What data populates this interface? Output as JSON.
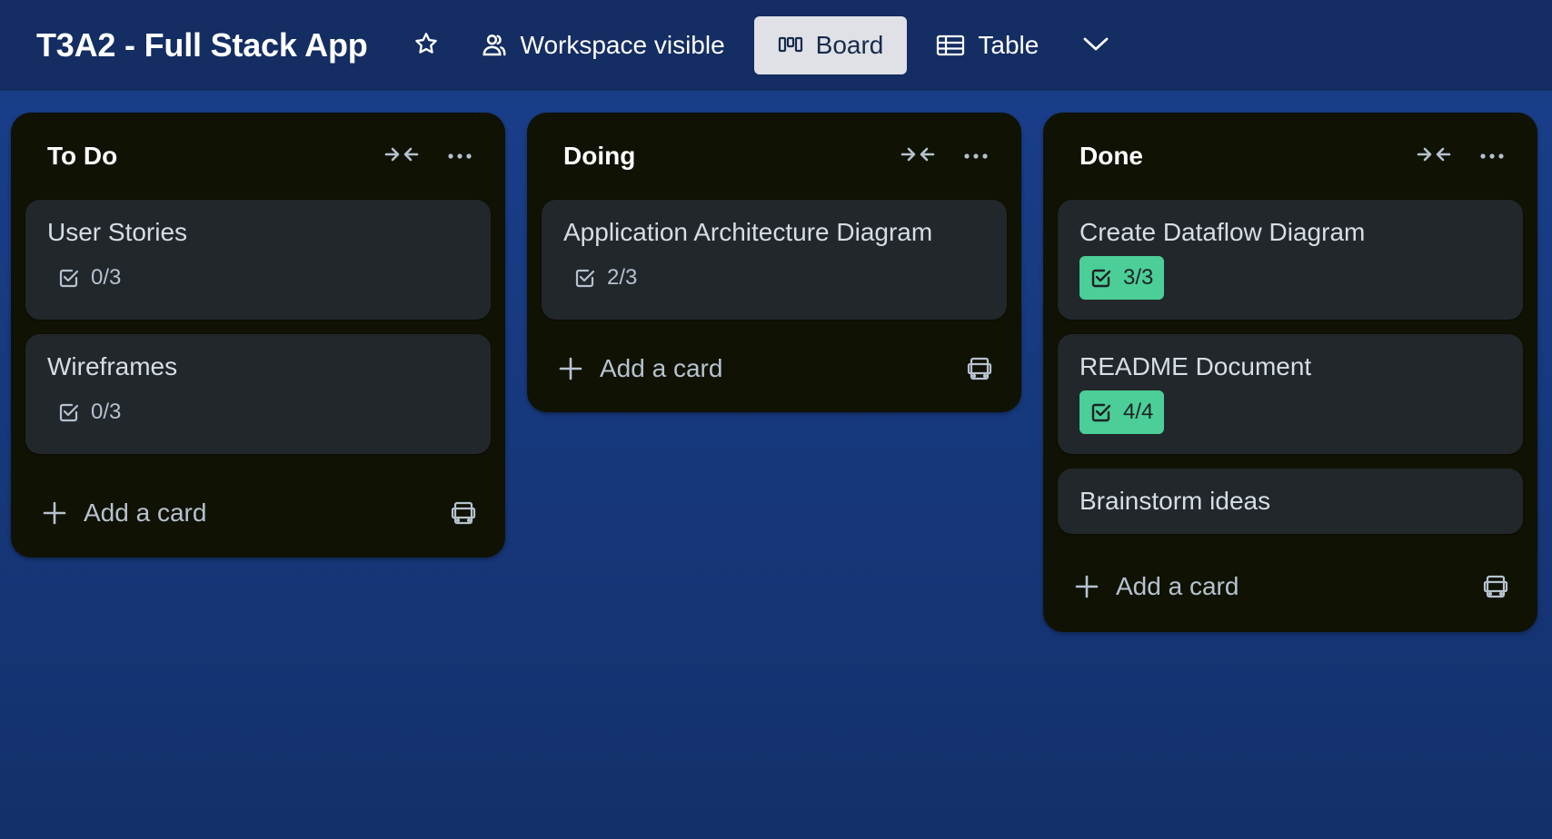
{
  "header": {
    "board_title": "T3A2 - Full Stack App",
    "visibility_label": "Workspace visible",
    "views": [
      {
        "label": "Board",
        "active": true
      },
      {
        "label": "Table",
        "active": false
      }
    ]
  },
  "colors": {
    "background": "#1a3f8c",
    "topbar": "#142d62",
    "list_bg": "#101204",
    "card_bg": "#22272b",
    "complete_badge": "#4bce97"
  },
  "lists": [
    {
      "title": "To Do",
      "cards": [
        {
          "title": "User Stories",
          "checklist": "0/3",
          "complete": false
        },
        {
          "title": "Wireframes",
          "checklist": "0/3",
          "complete": false
        }
      ],
      "add_label": "Add a card"
    },
    {
      "title": "Doing",
      "cards": [
        {
          "title": "Application Architecture Diagram",
          "checklist": "2/3",
          "complete": false
        }
      ],
      "add_label": "Add a card"
    },
    {
      "title": "Done",
      "cards": [
        {
          "title": "Create Dataflow Diagram",
          "checklist": "3/3",
          "complete": true
        },
        {
          "title": "README Document",
          "checklist": "4/4",
          "complete": true
        },
        {
          "title": "Brainstorm ideas"
        }
      ],
      "add_label": "Add a card"
    }
  ],
  "icons": [
    "star-icon",
    "people-icon",
    "board-icon",
    "table-icon",
    "chevron-down-icon",
    "collapse-icon",
    "more-icon",
    "checklist-icon",
    "plus-icon",
    "template-icon"
  ]
}
